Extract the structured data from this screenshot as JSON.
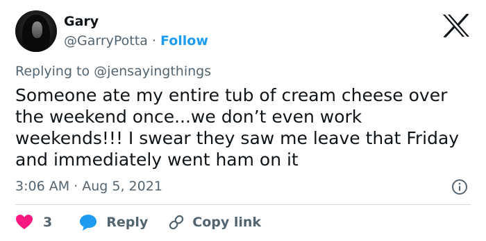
{
  "author": {
    "name": "Gary",
    "handle": "@GarryPotta",
    "separator": "·",
    "follow_label": "Follow"
  },
  "logo": {
    "icon": "x-logo-icon"
  },
  "replying": {
    "prefix": "Replying to",
    "mention": "@jensayingthings"
  },
  "tweet": {
    "text": "Someone ate my entire tub of cream cheese over the weekend once...we don’t even work weekends!!! I swear they saw me leave that Friday and immediately went ham on it"
  },
  "meta": {
    "time": "3:06 AM",
    "separator": "·",
    "date": "Aug 5, 2021"
  },
  "actions": {
    "like_count": "3",
    "reply_label": "Reply",
    "copy_label": "Copy link"
  },
  "colors": {
    "like": "#f91880",
    "reply": "#1d9bf0",
    "follow": "#1d9bf0",
    "secondary_text": "#536471",
    "primary_text": "#0f1419"
  }
}
